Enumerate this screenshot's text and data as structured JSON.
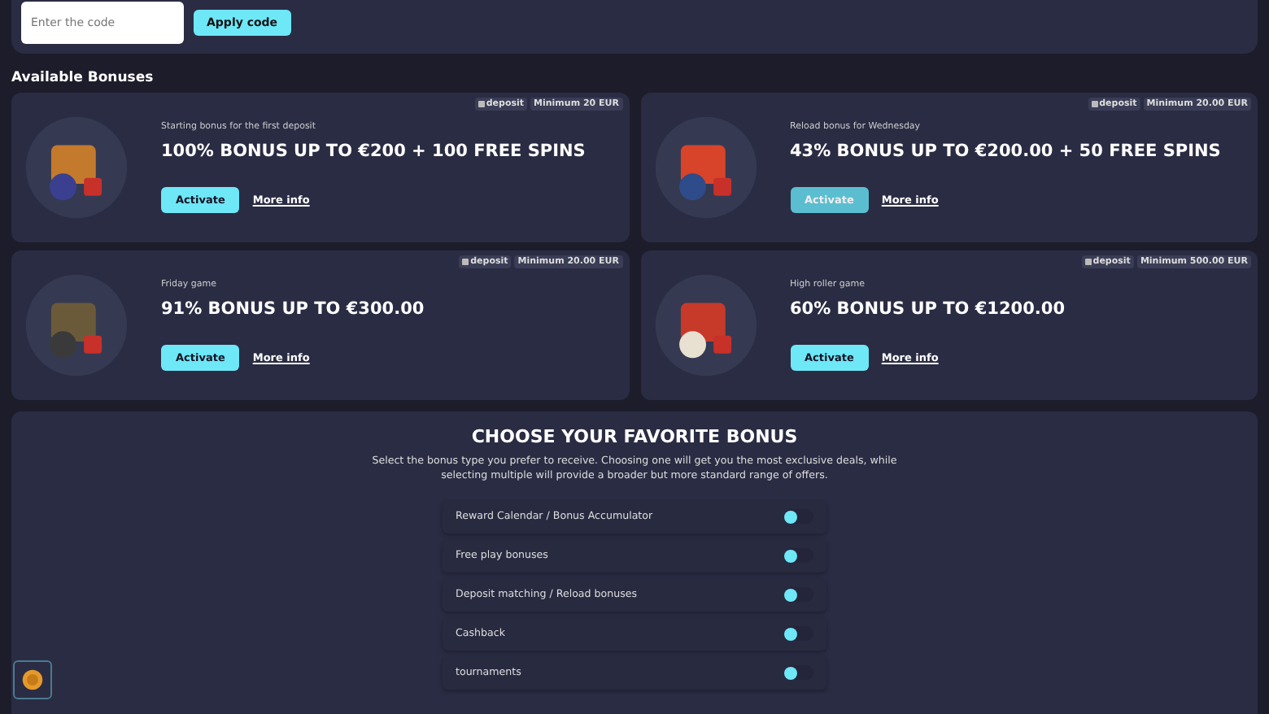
{
  "promo": {
    "placeholder": "Enter the code",
    "button": "Apply code"
  },
  "section_title": "Available Bonuses",
  "bonuses": [
    {
      "tag": "deposit",
      "minimum": "Minimum 20 EUR",
      "subtitle": "Starting bonus for the first deposit",
      "title": "100% BONUS UP TO €200 + 100 FREE SPINS",
      "activate": "Activate",
      "disabled": false,
      "more": "More info"
    },
    {
      "tag": "deposit",
      "minimum": "Minimum 20.00 EUR",
      "subtitle": "Reload bonus for Wednesday",
      "title": "43% BONUS UP TO €200.00 + 50 FREE SPINS",
      "activate": "Activate",
      "disabled": true,
      "more": "More info"
    },
    {
      "tag": "deposit",
      "minimum": "Minimum 20.00 EUR",
      "subtitle": "Friday game",
      "title": "91% BONUS UP TO €300.00",
      "activate": "Activate",
      "disabled": false,
      "more": "More info"
    },
    {
      "tag": "deposit",
      "minimum": "Minimum 500.00 EUR",
      "subtitle": "High roller game",
      "title": "60% BONUS UP TO €1200.00",
      "activate": "Activate",
      "disabled": false,
      "more": "More info"
    }
  ],
  "preferences": {
    "title": "CHOOSE YOUR FAVORITE BONUS",
    "description": "Select the bonus type you prefer to receive. Choosing one will get you the most exclusive deals, while selecting multiple will provide a broader but more standard range of offers.",
    "options": [
      {
        "label": "Reward Calendar / Bonus Accumulator",
        "on": false
      },
      {
        "label": "Free play bonuses",
        "on": false
      },
      {
        "label": "Deposit matching / Reload bonuses",
        "on": false
      },
      {
        "label": "Cashback",
        "on": false
      },
      {
        "label": "tournaments",
        "on": false
      }
    ]
  }
}
